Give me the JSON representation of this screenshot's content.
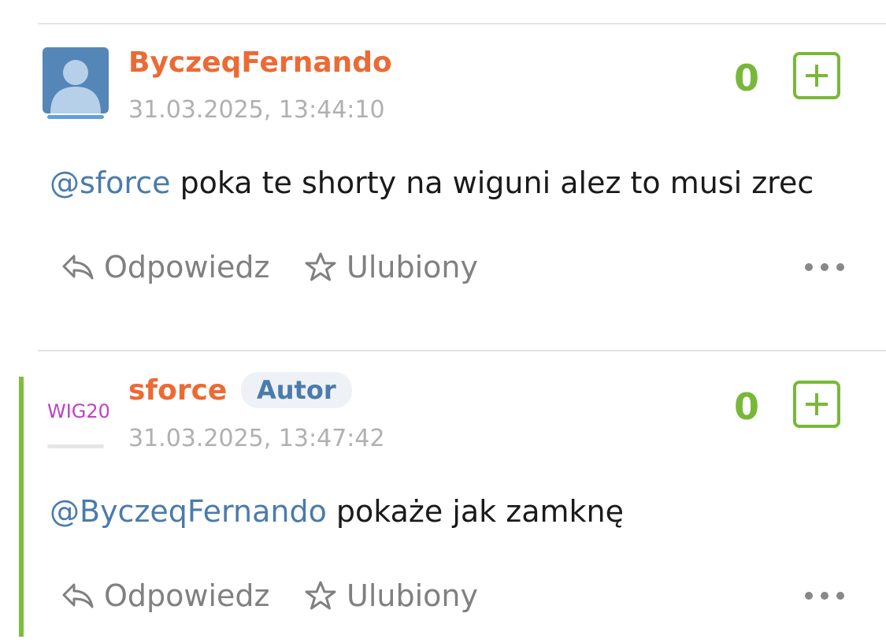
{
  "comments": [
    {
      "username": "ByczeqFernando",
      "timestamp": "31.03.2025, 13:44:10",
      "score": "0",
      "mention": "@sforce",
      "text": " poka te shorty na wiguni alez to musi zrec",
      "reply_label": "Odpowiedz",
      "favorite_label": "Ulubiony"
    },
    {
      "username": "sforce",
      "badge": "Autor",
      "avatar_text": "WIG20",
      "timestamp": "31.03.2025, 13:47:42",
      "score": "0",
      "mention": "@ByczeqFernando",
      "text": " pokaże jak zamknę",
      "reply_label": "Odpowiedz",
      "favorite_label": "Ulubiony"
    }
  ],
  "colors": {
    "username": "#ec6a35",
    "mention": "#4a7bac",
    "score": "#78b838",
    "accent": "#7cbf3f"
  }
}
